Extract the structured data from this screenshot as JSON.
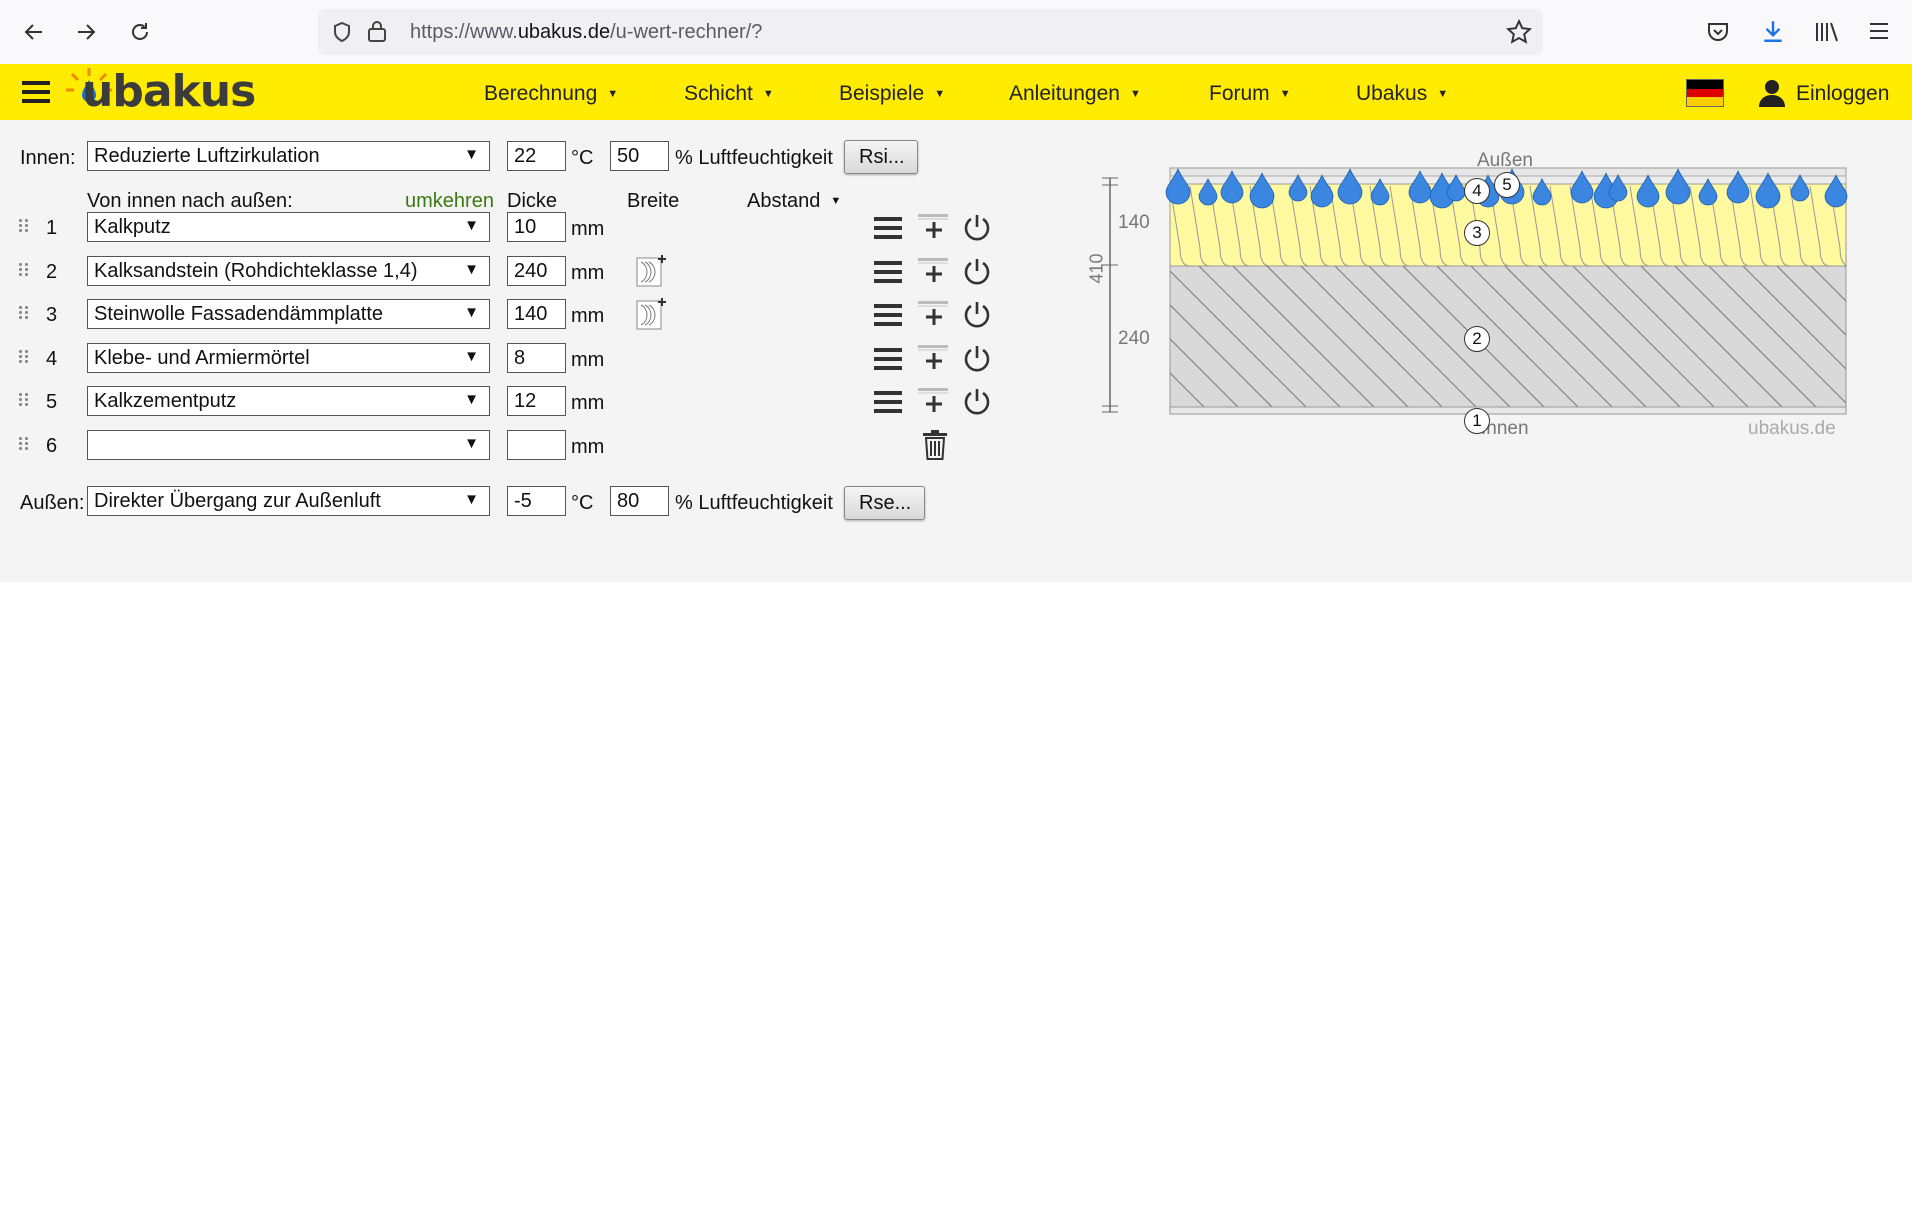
{
  "browser": {
    "url_prefix": "https://www.",
    "url_domain": "ubakus.de",
    "url_path": "/u-wert-rechner/?"
  },
  "header": {
    "logo": "ubakus",
    "menu": [
      {
        "label": "Berechnung"
      },
      {
        "label": "Schicht"
      },
      {
        "label": "Beispiele"
      },
      {
        "label": "Anleitungen"
      },
      {
        "label": "Forum"
      },
      {
        "label": "Ubakus"
      }
    ],
    "login_label": "Einloggen"
  },
  "form": {
    "inside": {
      "label": "Innen:",
      "selection": "Reduzierte Luftzirkulation",
      "temperature": "22",
      "temp_unit": "°C",
      "humidity": "50",
      "humidity_label": "% Luftfeuchtigkeit",
      "button": "Rsi..."
    },
    "columns": {
      "direction": "Von innen nach außen:",
      "reverse": "umkehren",
      "thickness": "Dicke",
      "width": "Breite",
      "spacing": "Abstand"
    },
    "layers": [
      {
        "num": "1",
        "material": "Kalkputz",
        "thickness": "10",
        "unit": "mm"
      },
      {
        "num": "2",
        "material": "Kalksandstein (Rohdichteklasse 1,4)",
        "thickness": "240",
        "unit": "mm"
      },
      {
        "num": "3",
        "material": "Steinwolle Fassadendämmplatte",
        "thickness": "140",
        "unit": "mm"
      },
      {
        "num": "4",
        "material": "Klebe- und Armiermörtel",
        "thickness": "8",
        "unit": "mm"
      },
      {
        "num": "5",
        "material": "Kalkzementputz",
        "thickness": "12",
        "unit": "mm"
      },
      {
        "num": "6",
        "material": "",
        "thickness": "",
        "unit": "mm"
      }
    ],
    "outside": {
      "label": "Außen:",
      "selection": "Direkter Übergang zur Außenluft",
      "temperature": "-5",
      "temp_unit": "°C",
      "humidity": "80",
      "humidity_label": "% Luftfeuchtigkeit",
      "button": "Rse..."
    }
  },
  "diagram": {
    "top_label": "Außen",
    "bottom_label": "Innen",
    "watermark": "ubakus.de",
    "total_dim": "410",
    "dim_insulation": "140",
    "dim_wall": "240",
    "markers": [
      "1",
      "2",
      "3",
      "4",
      "5"
    ],
    "colors": {
      "insulation": "#fff9a0",
      "masonry": "#d9d9d9",
      "drops": "#3a86e0"
    }
  }
}
